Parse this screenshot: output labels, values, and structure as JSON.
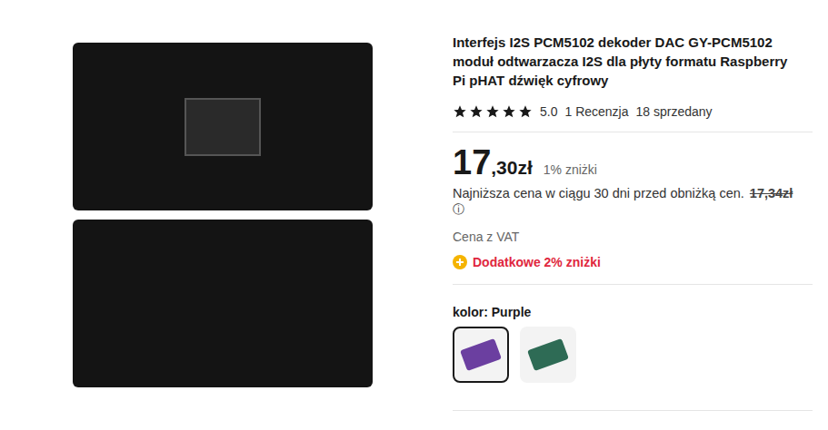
{
  "product": {
    "title": "Interfejs I2S PCM5102 dekoder DAC GY-PCM5102 moduł odtwarzacza I2S dla płyty formatu Raspberry Pi pHAT dźwięk cyfrowy",
    "stars": 5,
    "rating": "5.0",
    "reviews": "1 Recenzja",
    "sold": "18 sprzedany"
  },
  "price": {
    "main": "17",
    "fraction": ",30zł",
    "discount": "1% zniżki",
    "lowest_label": "Najniższa cena w ciągu 30 dni przed obniżką cen.",
    "lowest_price": "17,34zł",
    "info_icon": "ⓘ",
    "vat": "Cena z VAT",
    "extra_discount": "Dodatkowe 2% zniżki"
  },
  "color_picker": {
    "label": "kolor:",
    "value": "Purple",
    "options": [
      {
        "selected": true,
        "color": "#6b3fa0"
      },
      {
        "selected": false,
        "color": "#2e6b55"
      }
    ]
  }
}
